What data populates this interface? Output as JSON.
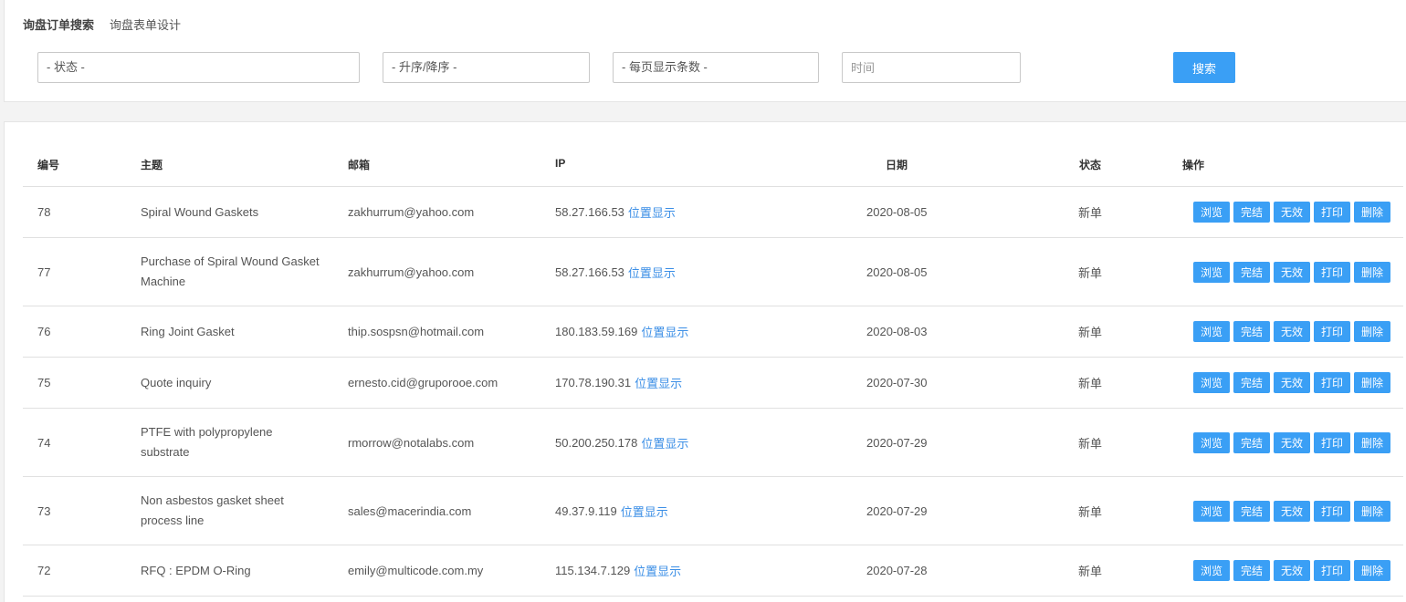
{
  "tabs": [
    "询盘订单搜索",
    "询盘表单设计"
  ],
  "filters": {
    "status": "- 状态 -",
    "order": "- 升序/降序 -",
    "per_page": "- 每页显示条数 -",
    "time_placeholder": "时间"
  },
  "search_label": "搜索",
  "columns": [
    "编号",
    "主题",
    "邮箱",
    "IP",
    "日期",
    "状态",
    "操作"
  ],
  "ip_link_label": "位置显示",
  "actions": [
    "浏览",
    "完结",
    "无效",
    "打印",
    "删除"
  ],
  "rows": [
    {
      "id": "78",
      "subject": "Spiral Wound Gaskets",
      "email": "zakhurrum@yahoo.com",
      "ip": "58.27.166.53",
      "date": "2020-08-05",
      "status": "新单"
    },
    {
      "id": "77",
      "subject": "Purchase of Spiral Wound Gasket Machine",
      "email": "zakhurrum@yahoo.com",
      "ip": "58.27.166.53",
      "date": "2020-08-05",
      "status": "新单"
    },
    {
      "id": "76",
      "subject": "Ring Joint Gasket",
      "email": "thip.sospsn@hotmail.com",
      "ip": "180.183.59.169",
      "date": "2020-08-03",
      "status": "新单"
    },
    {
      "id": "75",
      "subject": "Quote inquiry",
      "email": "ernesto.cid@gruporooe.com",
      "ip": "170.78.190.31",
      "date": "2020-07-30",
      "status": "新单"
    },
    {
      "id": "74",
      "subject": "PTFE with polypropylene substrate",
      "email": "rmorrow@notalabs.com",
      "ip": "50.200.250.178",
      "date": "2020-07-29",
      "status": "新单"
    },
    {
      "id": "73",
      "subject": "Non asbestos gasket sheet process line",
      "email": "sales@macerindia.com",
      "ip": "49.37.9.119",
      "date": "2020-07-29",
      "status": "新单"
    },
    {
      "id": "72",
      "subject": "RFQ : EPDM O-Ring",
      "email": "emily@multicode.com.my",
      "ip": "115.134.7.129",
      "date": "2020-07-28",
      "status": "新单"
    }
  ]
}
